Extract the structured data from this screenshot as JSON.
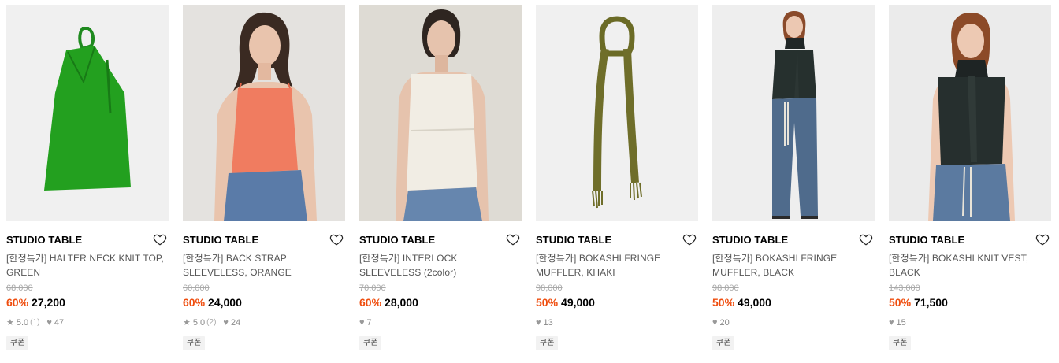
{
  "products": [
    {
      "brand": "STUDIO TABLE",
      "name": "[한정특가] HALTER NECK KNIT TOP, GREEN",
      "original_price": "68,000",
      "discount": "60%",
      "price": "27,200",
      "rating": "5.0",
      "review_count": "(1)",
      "likes": "47",
      "coupon": "쿠폰",
      "image": "green-halter-knit-top"
    },
    {
      "brand": "STUDIO TABLE",
      "name": "[한정특가] BACK STRAP SLEEVELESS, ORANGE",
      "original_price": "60,000",
      "discount": "60%",
      "price": "24,000",
      "rating": "5.0",
      "review_count": "(2)",
      "likes": "24",
      "coupon": "쿠폰",
      "image": "model-orange-camisole"
    },
    {
      "brand": "STUDIO TABLE",
      "name": "[한정특가] INTERLOCK SLEEVELESS (2color)",
      "original_price": "70,000",
      "discount": "60%",
      "price": "28,000",
      "likes": "7",
      "coupon": "쿠폰",
      "image": "model-ivory-sleeveless"
    },
    {
      "brand": "STUDIO TABLE",
      "name": "[한정특가] BOKASHI FRINGE MUFFLER, KHAKI",
      "original_price": "98,000",
      "discount": "50%",
      "price": "49,000",
      "likes": "13",
      "coupon": "쿠폰",
      "image": "khaki-fringe-muffler"
    },
    {
      "brand": "STUDIO TABLE",
      "name": "[한정특가] BOKASHI FRINGE MUFFLER, BLACK",
      "original_price": "98,000",
      "discount": "50%",
      "price": "49,000",
      "likes": "20",
      "coupon": "쿠폰",
      "image": "model-black-muffler-wide-jeans"
    },
    {
      "brand": "STUDIO TABLE",
      "name": "[한정특가] BOKASHI KNIT VEST, BLACK",
      "original_price": "143,000",
      "discount": "50%",
      "price": "71,500",
      "likes": "15",
      "coupon": "쿠폰",
      "image": "model-black-knit-vest"
    }
  ],
  "colors": {
    "discount": "#ef4d0e",
    "strike": "#aaaaaa",
    "meta": "#888888"
  },
  "icons": {
    "wishlist": "heart-outline-icon",
    "rating": "star-icon",
    "likes": "heart-filled-icon"
  }
}
